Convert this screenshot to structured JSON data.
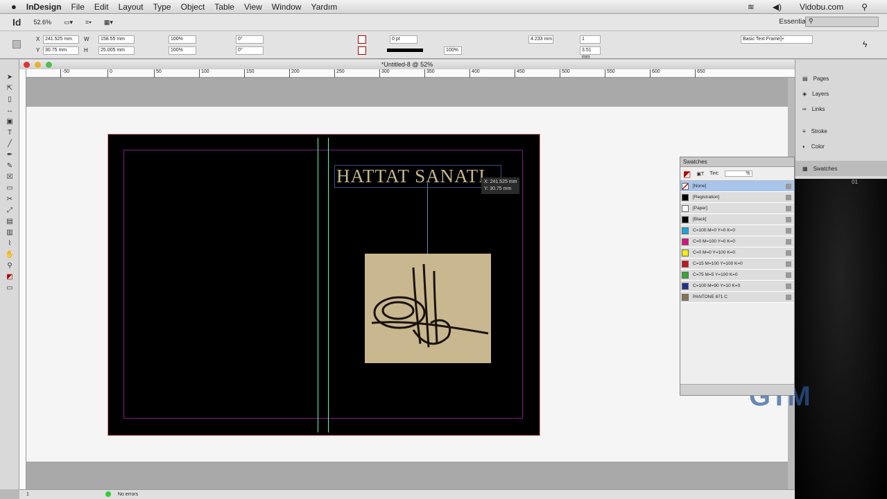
{
  "menubar": {
    "apple": "",
    "app": "InDesign",
    "items": [
      "File",
      "Edit",
      "Layout",
      "Type",
      "Object",
      "Table",
      "View",
      "Window",
      "Yardım"
    ],
    "site": "Vidobu.com"
  },
  "appbar": {
    "logo": "Id",
    "zoom": "52.6%",
    "workspace": "Essentials"
  },
  "control": {
    "x": "241.525 mm",
    "y": "30.75 mm",
    "w": "158.55 mm",
    "h": "25.005 mm",
    "scale_x": "100%",
    "scale_y": "100%",
    "rotate": "0°",
    "shear": "0°",
    "stroke": "0 pt",
    "opacity": "100%",
    "inset": "4.233 mm",
    "columns": "1",
    "gutter": "3.51 mm",
    "style": "Basic Text Frame]+"
  },
  "document": {
    "title": "*Untitled-8 @ 52%",
    "ruler": [
      "-50",
      "0",
      "50",
      "100",
      "150",
      "200",
      "250",
      "300",
      "350",
      "400",
      "450",
      "500",
      "550",
      "600",
      "650"
    ],
    "headline": "HATTAT SANATI",
    "tip_x": "X: 241.525 mm",
    "tip_y": "Y: 30.75 mm"
  },
  "panels": [
    {
      "label": "Pages"
    },
    {
      "label": "Layers"
    },
    {
      "label": "Links"
    },
    {
      "label": "Stroke"
    },
    {
      "label": "Color"
    },
    {
      "label": "Swatches"
    }
  ],
  "swatches": {
    "title": "Swatches",
    "tint_label": "Tint:",
    "tint_value": "%",
    "items": [
      {
        "name": "[None]",
        "color": "#ffffff"
      },
      {
        "name": "[Registration]",
        "color": "#000000"
      },
      {
        "name": "[Paper]",
        "color": "#ffffff"
      },
      {
        "name": "[Black]",
        "color": "#000000"
      },
      {
        "name": "C=100 M=0 Y=0 K=0",
        "color": "#19a7dc"
      },
      {
        "name": "C=0 M=100 Y=0 K=0",
        "color": "#d9137f"
      },
      {
        "name": "C=0 M=0 Y=100 K=0",
        "color": "#f2ee16"
      },
      {
        "name": "C=15 M=100 Y=100 K=0",
        "color": "#c4161c"
      },
      {
        "name": "C=75 M=5 Y=100 K=0",
        "color": "#3aa635"
      },
      {
        "name": "C=100 M=90 Y=10 K=0",
        "color": "#21318c"
      },
      {
        "name": "PANTONE 871 C",
        "color": "#857554"
      }
    ]
  },
  "status": {
    "page": "1",
    "errors": "No errors"
  },
  "overlay": {
    "logo": "GTM",
    "page_num": "01"
  }
}
